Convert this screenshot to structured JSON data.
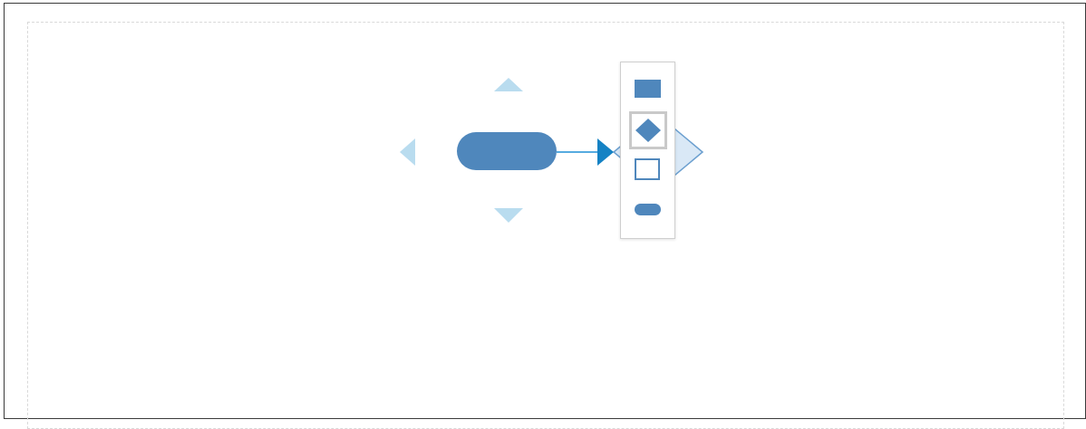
{
  "editor": {
    "palette": {
      "items": [
        {
          "name": "rectangle",
          "icon": "filled-rectangle-icon",
          "selected": false
        },
        {
          "name": "diamond",
          "icon": "diamond-icon",
          "selected": true
        },
        {
          "name": "square",
          "icon": "outlined-square-icon",
          "selected": false
        },
        {
          "name": "rounded-rectangle",
          "icon": "rounded-rectangle-icon",
          "selected": false
        }
      ]
    },
    "colors": {
      "shape_fill": "#4f87bc",
      "connector": "#1f8fd6",
      "arrow_hint": "#b9dcef",
      "preview_fill": "#d2e4f4",
      "preview_stroke": "#6b9fcf",
      "palette_border": "#cfcfcf",
      "selection_border": "#c9c9c9"
    }
  }
}
